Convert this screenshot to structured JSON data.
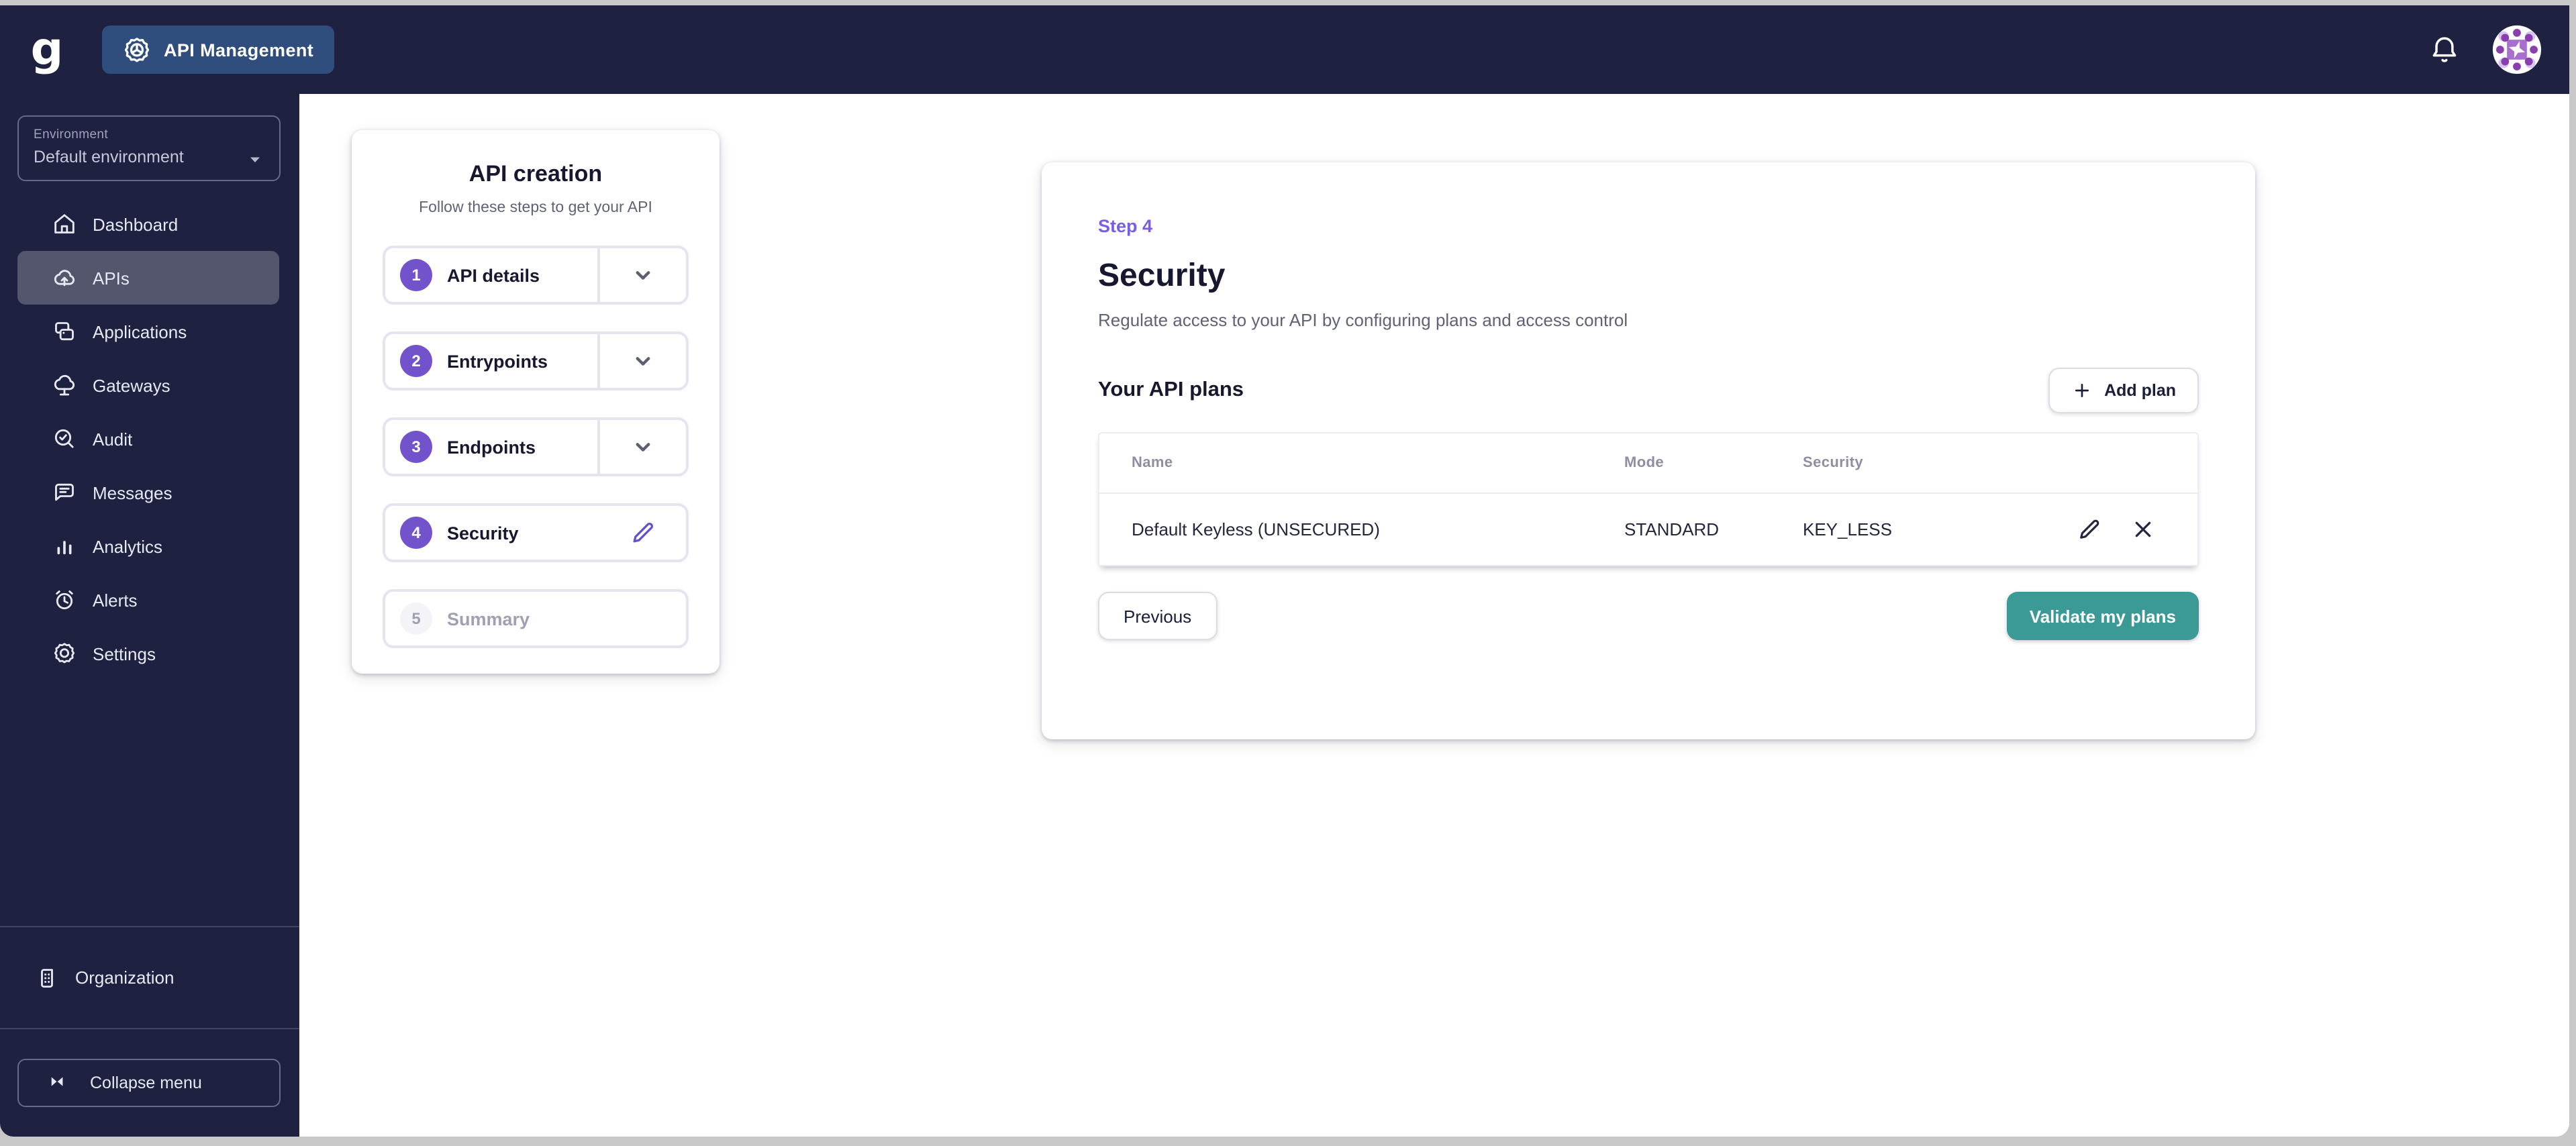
{
  "header": {
    "logo_letter": "g",
    "product_label": "API Management"
  },
  "sidebar": {
    "environment": {
      "label": "Environment",
      "value": "Default environment"
    },
    "items": [
      {
        "label": "Dashboard",
        "icon": "home-icon",
        "selected": false
      },
      {
        "label": "APIs",
        "icon": "cloud-upload-icon",
        "selected": true
      },
      {
        "label": "Applications",
        "icon": "applications-icon",
        "selected": false
      },
      {
        "label": "Gateways",
        "icon": "cloud-gateway-icon",
        "selected": false
      },
      {
        "label": "Audit",
        "icon": "audit-search-icon",
        "selected": false
      },
      {
        "label": "Messages",
        "icon": "message-icon",
        "selected": false
      },
      {
        "label": "Analytics",
        "icon": "bar-chart-icon",
        "selected": false
      },
      {
        "label": "Alerts",
        "icon": "alarm-clock-icon",
        "selected": false
      },
      {
        "label": "Settings",
        "icon": "gear-icon",
        "selected": false
      }
    ],
    "organization_label": "Organization",
    "collapse_label": "Collapse menu"
  },
  "stepper": {
    "title": "API creation",
    "subtitle": "Follow these steps to get your API",
    "steps": [
      {
        "number": "1",
        "label": "API details",
        "action": "chevron",
        "disabled": false
      },
      {
        "number": "2",
        "label": "Entrypoints",
        "action": "chevron",
        "disabled": false
      },
      {
        "number": "3",
        "label": "Endpoints",
        "action": "chevron",
        "disabled": false
      },
      {
        "number": "4",
        "label": "Security",
        "action": "edit",
        "disabled": false
      },
      {
        "number": "5",
        "label": "Summary",
        "action": "none",
        "disabled": true
      }
    ]
  },
  "main": {
    "step_label": "Step 4",
    "title": "Security",
    "description": "Regulate access to your API by configuring plans and access control",
    "plans_heading": "Your API plans",
    "add_plan_label": "Add plan",
    "table": {
      "columns": [
        "Name",
        "Mode",
        "Security"
      ],
      "rows": [
        {
          "name": "Default Keyless (UNSECURED)",
          "mode": "STANDARD",
          "security": "KEY_LESS"
        }
      ]
    },
    "previous_label": "Previous",
    "validate_label": "Validate my plans"
  },
  "colors": {
    "topbar_navy": "#1f2141",
    "product_badge_blue": "#2f4d7d",
    "accent_purple": "#7353cb",
    "step_link_purple": "#7b5ce5",
    "validate_teal": "#3b9a95"
  }
}
